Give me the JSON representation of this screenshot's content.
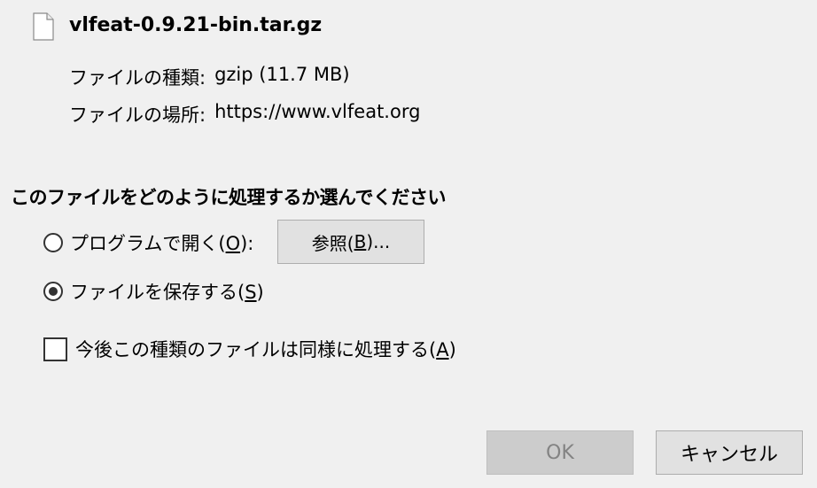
{
  "file": {
    "name": "vlfeat-0.9.21-bin.tar.gz",
    "type_label": "ファイルの種類:",
    "type_value": "gzip (11.7 MB)",
    "from_label": "ファイルの場所:",
    "from_value": "https://www.vlfeat.org"
  },
  "question": "このファイルをどのように処理するか選んでください",
  "options": {
    "open_with": {
      "label_pre": "プログラムで開く(",
      "accel": "O",
      "label_post": "):",
      "selected": false
    },
    "browse_button": {
      "label_pre": "参照(",
      "accel": "B",
      "label_post": ")..."
    },
    "save_file": {
      "label_pre": "ファイルを保存する(",
      "accel": "S",
      "label_post": ")",
      "selected": true
    },
    "remember": {
      "label_pre": "今後この種類のファイルは同様に処理する(",
      "accel": "A",
      "label_post": ")",
      "checked": false
    }
  },
  "buttons": {
    "ok": "OK",
    "cancel": "キャンセル"
  }
}
